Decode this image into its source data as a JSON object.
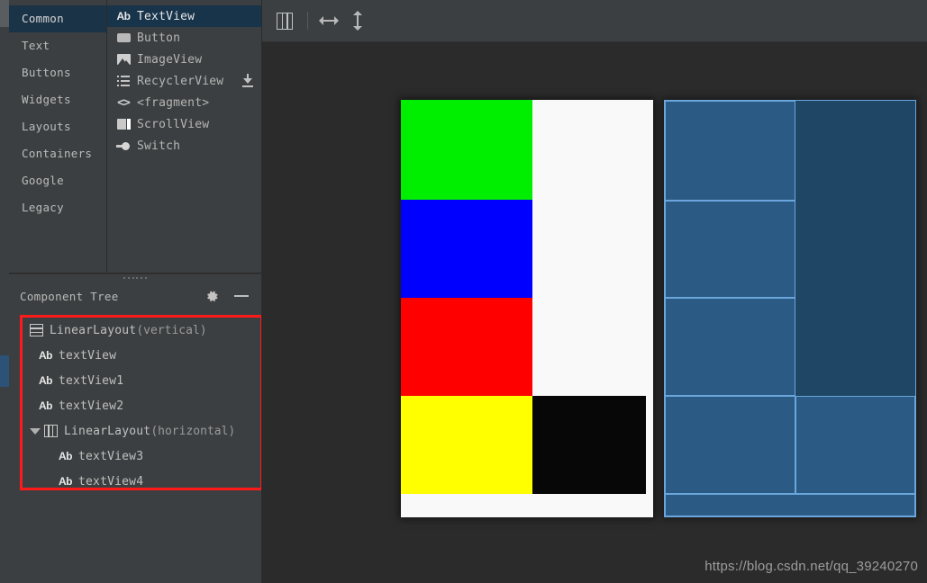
{
  "palette": {
    "categories": [
      {
        "label": "Common",
        "selected": true
      },
      {
        "label": "Text",
        "selected": false
      },
      {
        "label": "Buttons",
        "selected": false
      },
      {
        "label": "Widgets",
        "selected": false
      },
      {
        "label": "Layouts",
        "selected": false
      },
      {
        "label": "Containers",
        "selected": false
      },
      {
        "label": "Google",
        "selected": false
      },
      {
        "label": "Legacy",
        "selected": false
      }
    ],
    "widgets": [
      {
        "label": "TextView",
        "icon": "text-ab-icon",
        "selected": true,
        "download": false
      },
      {
        "label": "Button",
        "icon": "button-icon",
        "selected": false,
        "download": false
      },
      {
        "label": "ImageView",
        "icon": "image-icon",
        "selected": false,
        "download": false
      },
      {
        "label": "RecyclerView",
        "icon": "list-icon",
        "selected": false,
        "download": true
      },
      {
        "label": "<fragment>",
        "icon": "code-brackets-icon",
        "selected": false,
        "download": false
      },
      {
        "label": "ScrollView",
        "icon": "scrollview-icon",
        "selected": false,
        "download": false
      },
      {
        "label": "Switch",
        "icon": "switch-icon",
        "selected": false,
        "download": false
      }
    ]
  },
  "component_tree": {
    "title": "Component Tree",
    "gear_icon": "gear-icon",
    "minimize_icon": "minimize-icon",
    "nodes": [
      {
        "name": "LinearLayout",
        "qualifier": "(vertical)",
        "icon": "linearlayout-vertical-icon",
        "indent": 0,
        "expander": ""
      },
      {
        "name": "textView",
        "qualifier": "",
        "icon": "text-ab-icon",
        "indent": 1,
        "expander": ""
      },
      {
        "name": "textView1",
        "qualifier": "",
        "icon": "text-ab-icon",
        "indent": 1,
        "expander": ""
      },
      {
        "name": "textView2",
        "qualifier": "",
        "icon": "text-ab-icon",
        "indent": 1,
        "expander": ""
      },
      {
        "name": "LinearLayout",
        "qualifier": "(horizontal)",
        "icon": "linearlayout-horizontal-icon",
        "indent": 0,
        "expander": "expanded"
      },
      {
        "name": "textView3",
        "qualifier": "",
        "icon": "text-ab-icon",
        "indent": 2,
        "expander": ""
      },
      {
        "name": "textView4",
        "qualifier": "",
        "icon": "text-ab-icon",
        "indent": 2,
        "expander": ""
      }
    ],
    "highlight_color": "#ff1a1a"
  },
  "toolbar": {
    "buttons": [
      {
        "name": "view-mode-button",
        "icon": "columns-icon"
      },
      {
        "name": "fit-horizontal-button",
        "icon": "horizontal-arrow-icon"
      },
      {
        "name": "fit-vertical-button",
        "icon": "vertical-arrow-icon"
      }
    ]
  },
  "preview": {
    "design_rows": [
      {
        "height_pct": 24.0,
        "cells": [
          {
            "color": "#00ee00",
            "width_pct": 52
          }
        ],
        "tail": "#f9f9f9"
      },
      {
        "height_pct": 23.5,
        "cells": [
          {
            "color": "#0000ff",
            "width_pct": 52
          }
        ],
        "tail": "#f9f9f9"
      },
      {
        "height_pct": 23.5,
        "cells": [
          {
            "color": "#ff0000",
            "width_pct": 52
          }
        ],
        "tail": "#f9f9f9"
      },
      {
        "height_pct": 23.5,
        "cells": [
          {
            "color": "#ffff00",
            "width_pct": 52
          },
          {
            "color": "#070707",
            "width_pct": 48
          }
        ],
        "tail": ""
      },
      {
        "height_pct": 5.5,
        "cells": [],
        "tail": "#f9f9f9"
      }
    ],
    "blueprint_rows": [
      {
        "height_pct": 24.0,
        "cells": [
          {
            "width_pct": 52,
            "filled": true
          }
        ],
        "tail_filled": false
      },
      {
        "height_pct": 23.5,
        "cells": [
          {
            "width_pct": 52,
            "filled": true
          }
        ],
        "tail_filled": false
      },
      {
        "height_pct": 23.5,
        "cells": [
          {
            "width_pct": 52,
            "filled": true
          }
        ],
        "tail_filled": false
      },
      {
        "height_pct": 23.5,
        "cells": [
          {
            "width_pct": 52,
            "filled": true
          },
          {
            "width_pct": 48,
            "filled": true
          }
        ],
        "tail_filled": false
      },
      {
        "height_pct": 5.5,
        "cells": [
          {
            "width_pct": 100,
            "filled": true
          }
        ],
        "tail_filled": false
      }
    ],
    "colors": {
      "blueprint_fill": "#2b5b84",
      "blueprint_background": "#1f4765",
      "blueprint_stroke": "#6aa5dc",
      "canvas_background": "#2b2b2b",
      "device_background": "#f9f9f9"
    }
  },
  "watermark": {
    "text": "https://blog.csdn.net/qq_39240270"
  }
}
